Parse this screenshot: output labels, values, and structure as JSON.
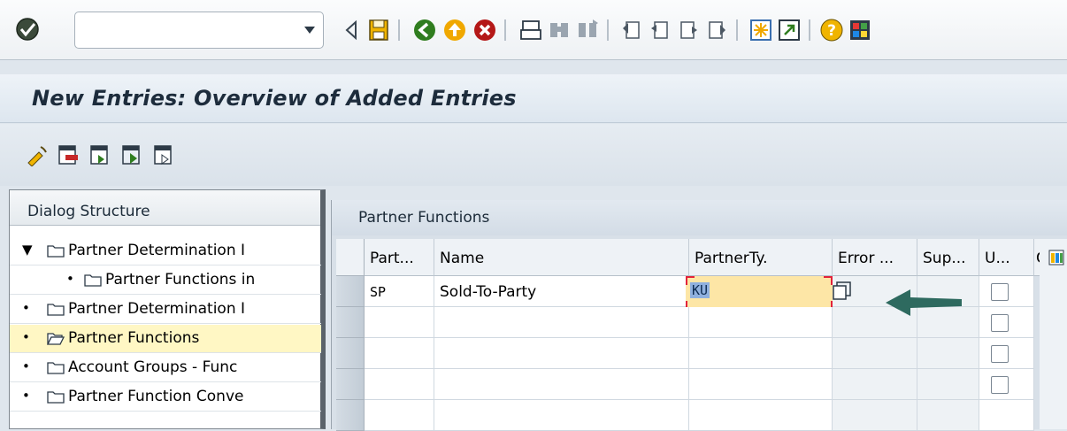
{
  "toolbar": {
    "command_field": {
      "value": "",
      "placeholder": ""
    },
    "icons": [
      "ok-icon",
      "back-icon",
      "save-icon",
      "nav-back-icon",
      "exit-icon",
      "cancel-icon",
      "print-icon",
      "find-icon",
      "find-next-icon",
      "first-page-icon",
      "prev-page-icon",
      "next-page-icon",
      "last-page-icon",
      "create-session-icon",
      "shortcut-icon",
      "help-icon",
      "layout-icon"
    ]
  },
  "title": {
    "text": "New Entries: Overview of Added Entries"
  },
  "app_toolbar": {
    "icons": [
      "change-icon",
      "delete-icon",
      "select-all-icon",
      "select-block-icon",
      "deselect-all-icon"
    ]
  },
  "dialog": {
    "header": "Dialog Structure",
    "items": [
      {
        "label": "Partner Determination I",
        "expander": "▼",
        "selected": false
      },
      {
        "label": "Partner Functions in",
        "expander": "•",
        "selected": false
      },
      {
        "label": "Partner Determination I",
        "expander": "•",
        "selected": false
      },
      {
        "label": "Partner Functions",
        "expander": "•",
        "selected": true
      },
      {
        "label": "Account Groups - Func",
        "expander": "•",
        "selected": false
      },
      {
        "label": "Partner Function Conve",
        "expander": "•",
        "selected": false
      }
    ]
  },
  "table": {
    "caption": "Partner Functions",
    "columns": [
      "Part...",
      "Name",
      "PartnerTy.",
      "Error ...",
      "Sup...",
      "U...",
      "C"
    ],
    "rows": [
      {
        "partner": "SP",
        "name": "Sold-To-Party",
        "partner_type": "KU"
      }
    ]
  }
}
